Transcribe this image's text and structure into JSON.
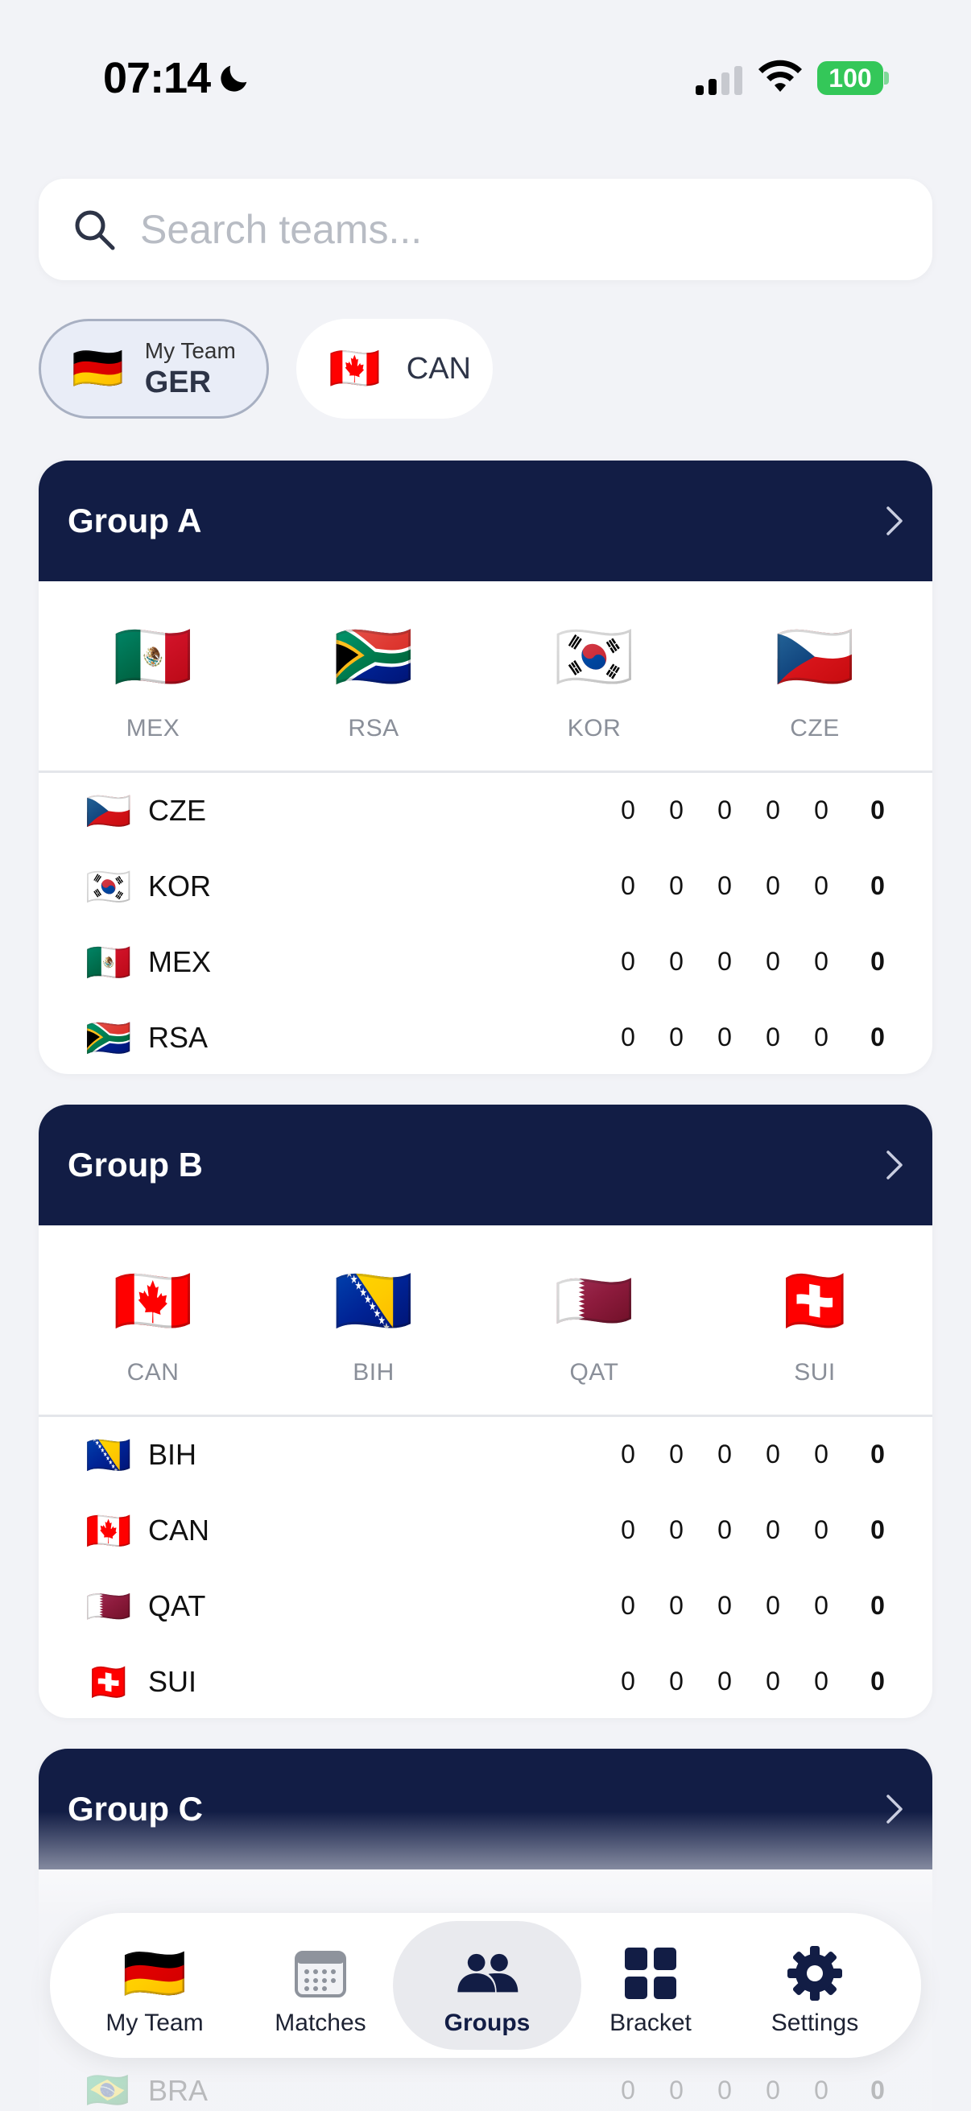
{
  "status": {
    "time": "07:14",
    "battery": "100"
  },
  "search": {
    "placeholder": "Search teams..."
  },
  "chips": {
    "my_team_label": "My Team",
    "my_team_code": "GER",
    "my_team_flag": "🇩🇪",
    "second_code": "CAN",
    "second_flag": "🇨🇦"
  },
  "groups": [
    {
      "title": "Group A",
      "flags": [
        {
          "flag": "🇲🇽",
          "code": "MEX"
        },
        {
          "flag": "🇿🇦",
          "code": "RSA"
        },
        {
          "flag": "🇰🇷",
          "code": "KOR"
        },
        {
          "flag": "🇨🇿",
          "code": "CZE"
        }
      ],
      "rows": [
        {
          "flag": "🇨🇿",
          "code": "CZE",
          "stats": [
            "0",
            "0",
            "0",
            "0",
            "0"
          ],
          "pts": "0"
        },
        {
          "flag": "🇰🇷",
          "code": "KOR",
          "stats": [
            "0",
            "0",
            "0",
            "0",
            "0"
          ],
          "pts": "0"
        },
        {
          "flag": "🇲🇽",
          "code": "MEX",
          "stats": [
            "0",
            "0",
            "0",
            "0",
            "0"
          ],
          "pts": "0"
        },
        {
          "flag": "🇿🇦",
          "code": "RSA",
          "stats": [
            "0",
            "0",
            "0",
            "0",
            "0"
          ],
          "pts": "0"
        }
      ]
    },
    {
      "title": "Group B",
      "flags": [
        {
          "flag": "🇨🇦",
          "code": "CAN"
        },
        {
          "flag": "🇧🇦",
          "code": "BIH"
        },
        {
          "flag": "🇶🇦",
          "code": "QAT"
        },
        {
          "flag": "🇨🇭",
          "code": "SUI"
        }
      ],
      "rows": [
        {
          "flag": "🇧🇦",
          "code": "BIH",
          "stats": [
            "0",
            "0",
            "0",
            "0",
            "0"
          ],
          "pts": "0"
        },
        {
          "flag": "🇨🇦",
          "code": "CAN",
          "stats": [
            "0",
            "0",
            "0",
            "0",
            "0"
          ],
          "pts": "0"
        },
        {
          "flag": "🇶🇦",
          "code": "QAT",
          "stats": [
            "0",
            "0",
            "0",
            "0",
            "0"
          ],
          "pts": "0"
        },
        {
          "flag": "🇨🇭",
          "code": "SUI",
          "stats": [
            "0",
            "0",
            "0",
            "0",
            "0"
          ],
          "pts": "0"
        }
      ]
    },
    {
      "title": "Group C"
    }
  ],
  "partial_row": {
    "flag": "🇧🇷",
    "code": "BRA",
    "stats": [
      "0",
      "0",
      "0",
      "0",
      "0"
    ],
    "pts": "0"
  },
  "nav": {
    "my_team": "My Team",
    "my_team_flag": "🇩🇪",
    "matches": "Matches",
    "groups": "Groups",
    "bracket": "Bracket",
    "settings": "Settings",
    "active": "groups"
  },
  "colors": {
    "header_navy": "#121d45",
    "battery_green": "#34c759",
    "background": "#f2f3f7"
  }
}
